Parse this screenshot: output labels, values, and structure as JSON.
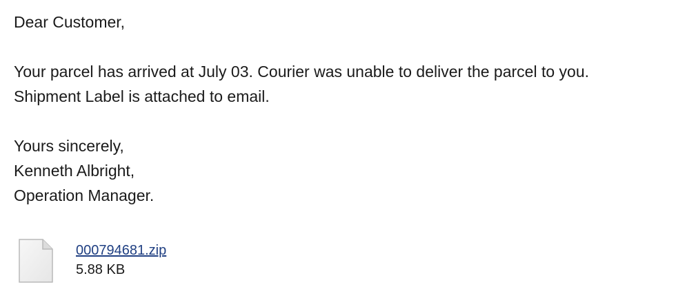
{
  "message": {
    "greeting": "Dear Customer,",
    "body_line_1": "Your parcel has arrived at July 03. Courier was unable to deliver the parcel to you.",
    "body_line_2": "Shipment Label is attached to email.",
    "closing": "Yours sincerely,",
    "signature_name": "Kenneth Albright,",
    "signature_title": "Operation Manager."
  },
  "attachment": {
    "icon": "file-icon",
    "filename": "000794681.zip",
    "size": "5.88 KB",
    "link_color": "#1f3f82"
  }
}
